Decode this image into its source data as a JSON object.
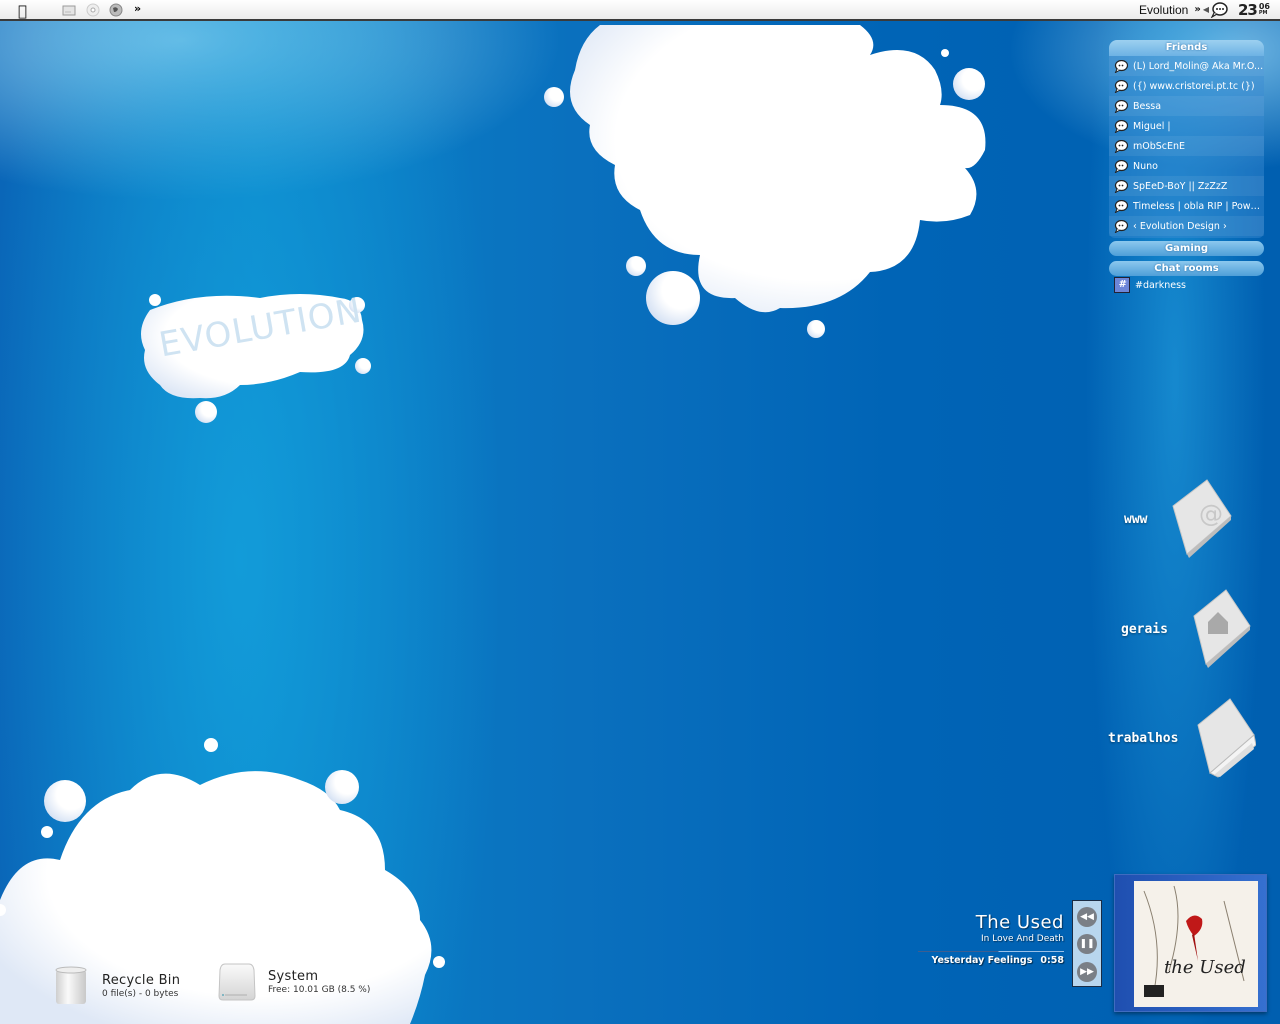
{
  "menubar": {
    "apple_icon": "apple-logo-icon",
    "left_icons": [
      "drive-icon",
      "cd-icon",
      "globe-icon"
    ],
    "overflow_label": "»",
    "app_title": "Evolution",
    "right_overflow_label": "»",
    "tray_icon": "chat-bubble-icon",
    "clock": {
      "hour": "23",
      "minute": "06",
      "ampm": "PM"
    }
  },
  "wallpaper": {
    "logo_text": "EVOLUTION",
    "colors": {
      "bg_dark": "#005fb0",
      "bg_light": "#0a82c8",
      "cloud": "#ffffff"
    }
  },
  "contacts": {
    "friends_header": "Friends",
    "friends": [
      {
        "name": "(L) Lord_Molin@ Aka Mr.O...",
        "icon": "chat-bubble-icon"
      },
      {
        "name": "({) www.cristorei.pt.tc (})",
        "icon": "chat-bubble-icon"
      },
      {
        "name": "Bessa",
        "icon": "chat-bubble-icon"
      },
      {
        "name": "Miguel |",
        "icon": "chat-bubble-icon"
      },
      {
        "name": "mObScEnE",
        "icon": "chat-bubble-icon"
      },
      {
        "name": "Nuno",
        "icon": "chat-bubble-icon"
      },
      {
        "name": "SpEeD-BoY || ZzZzZ",
        "icon": "chat-bubble-icon"
      },
      {
        "name": "Timeless | obla RIP | Powe...",
        "icon": "chat-bubble-icon"
      },
      {
        "name": "‹ Evolution Design ›",
        "icon": "chat-bubble-icon"
      }
    ],
    "gaming_header": "Gaming",
    "chatrooms_header": "Chat rooms",
    "chatrooms": [
      {
        "name": "#darkness",
        "icon": "hash-room-icon"
      }
    ]
  },
  "shortcuts": [
    {
      "label": "www",
      "icon": "at-sign-folder-icon"
    },
    {
      "label": "gerais",
      "icon": "home-folder-icon"
    },
    {
      "label": "trabalhos",
      "icon": "documents-folder-icon"
    }
  ],
  "player": {
    "artist": "The Used",
    "album": "In Love And Death",
    "track": "Yesterday Feelings",
    "time": "0:58",
    "progress_fraction": 0.55,
    "prev_label": "◀◀",
    "pause_label": "❚❚",
    "next_label": "▶▶",
    "cover_icon": "album-cover-image"
  },
  "desktop": {
    "recycle_bin": {
      "name": "Recycle Bin",
      "info": "0 file(s) - 0 bytes"
    },
    "system": {
      "name": "System",
      "info": "Free: 10.01 GB (8.5 %)"
    }
  }
}
